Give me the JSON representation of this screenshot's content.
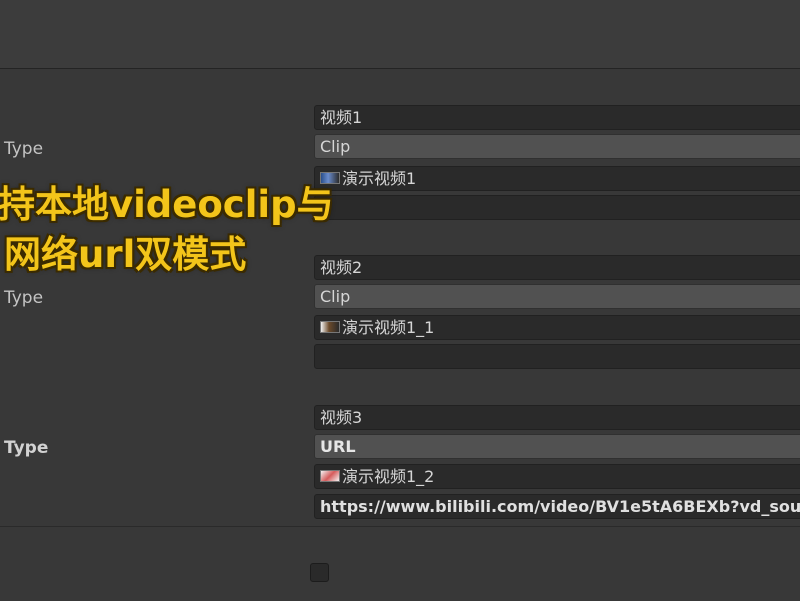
{
  "videos": [
    {
      "name": "视频1",
      "type_label": "Type",
      "type_value": "Clip",
      "clip_name": "演示视频1",
      "url": ""
    },
    {
      "name": "视频2",
      "type_label": "Type",
      "type_value": "Clip",
      "clip_name": "演示视频1_1",
      "url": ""
    },
    {
      "name": "视频3",
      "type_label": "Type",
      "type_value": "URL",
      "clip_name": "演示视频1_2",
      "url": "https://www.bilibili.com/video/BV1e5tA6BEXb?vd_sou"
    }
  ],
  "overlay": {
    "line1": "持本地videoclip与",
    "line2": "网络url双模式",
    "color": "#f3c51a"
  },
  "icons": {
    "clip_thumbnail": "video-thumbnail-icon"
  }
}
